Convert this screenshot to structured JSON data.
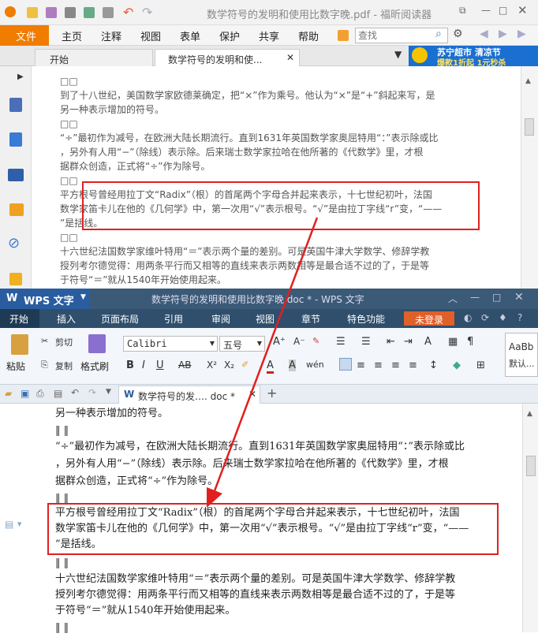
{
  "foxit": {
    "title": "数学符号的发明和使用比数字晚.pdf - 福昕阅读器",
    "menu": [
      "文件",
      "主页",
      "注释",
      "视图",
      "表单",
      "保护",
      "共享",
      "帮助"
    ],
    "search_placeholder": "查找",
    "tabs": [
      "开始",
      "数学符号的发明和使..."
    ],
    "ad": {
      "line1": "苏宁超市 清凉节",
      "line2": "爆款1折起 1元秒杀"
    },
    "lines": [
      "□□",
      "到了十八世纪，美国数学家欧德莱确定，把“×”作为乘号。他认为“×”是“+”斜起来写，是",
      "另一种表示增加的符号。",
      "□□",
      "“÷”最初作为减号，在欧洲大陆长期流行。直到1631年英国数学家奥屈特用“：”表示除或比",
      "，另外有人用“−”（除线）表示除。后来瑞士数学家拉哈在他所著的《代数学》里，才根",
      "据群众创造，正式将“÷”作为除号。",
      "□□",
      "平方根号曾经用拉丁文“Radix”（根）的首尾两个字母合并起来表示，十七世纪初叶，法国",
      "数学家笛卡儿在他的《几何学》中，第一次用“√”表示根号。“√”是由拉丁字线“r”变，“——",
      "”是括线。",
      "□□",
      "十六世纪法国数学家维叶特用“＝”表示两个量的差别。可是英国牛津大学数学、修辞学教",
      "授列考尔德觉得：用两条平行而又相等的直线来表示两数相等是最合适不过的了，于是等",
      "于符号“＝”就从1540年开始使用起来。"
    ]
  },
  "wps": {
    "app": "WPS 文字",
    "title": "数学符号的发明和使用比数字晚.doc * - WPS 文字",
    "menu": [
      "开始",
      "插入",
      "页面布局",
      "引用",
      "审阅",
      "视图",
      "章节",
      "特色功能"
    ],
    "login": "未登录",
    "ribbon": {
      "paste": "粘贴",
      "cut": "剪切",
      "copy": "复制",
      "format_painter": "格式刷",
      "font": "Calibri",
      "size": "五号",
      "style_preview": "AaBb",
      "style_name": "默认..."
    },
    "tab": "数学符号的发…. doc *",
    "lines": [
      "另一种表示增加的符号。",
      "‖ ‖",
      "“÷”最初作为减号，在欧洲大陆长期流行。直到1631年英国数学家奥屈特用“：”表示除或比",
      "，另外有人用“−”（除线）表示除。后来瑞士数学家拉哈在他所著的《代数学》里，才根",
      "据群众创造，正式将“÷”作为除号。",
      "‖ ‖",
      "平方根号曾经用拉丁文“Radix”（根）的首尾两个字母合并起来表示，十七世纪初叶，法国",
      "数学家笛卡儿在他的《几何学》中，第一次用“√”表示根号。“√”是由拉丁字线“r”变，“——",
      "”是括线。",
      "‖ ‖",
      "十六世纪法国数学家维叶特用“＝”表示两个量的差别。可是英国牛津大学数学、修辞学教",
      "授列考尔德觉得：用两条平行而又相等的直线来表示两数相等是最合适不过的了，于是等",
      "于符号“＝”就从1540年开始使用起来。",
      "‖ ‖"
    ]
  },
  "colors": {
    "foxit_orange": "#f07c00",
    "wps_blue": "#2f4f6d",
    "highlight": "#e02020"
  }
}
